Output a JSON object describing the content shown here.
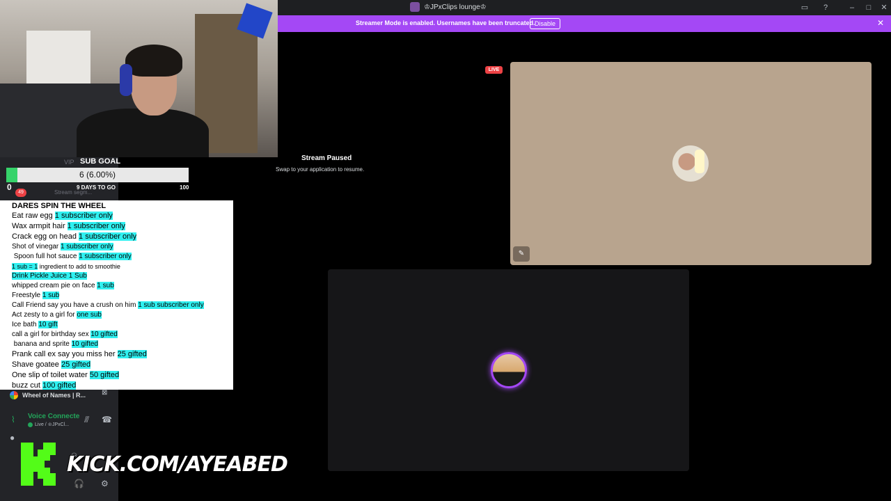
{
  "window": {
    "title": "♔JPxClips lounge♔"
  },
  "banner": {
    "text": "Streamer Mode is enabled. Usernames have been truncated.",
    "button_label": "Disable",
    "color": "#a448f5"
  },
  "sub_goal": {
    "title": "SUB GOAL",
    "value_text": "6 (6.00%)",
    "progress_percent": 6,
    "start_label": "0",
    "end_label": "100",
    "days_label": "9 DAYS TO GO",
    "vip_label": "VIP",
    "badge_count": "49",
    "segment_label": "Stream segm..."
  },
  "dares": {
    "title": "DARES SPIN THE WHEEL",
    "items": [
      {
        "text": "Eat raw egg ",
        "tag": "1 subscriber only"
      },
      {
        "text": "Wax armpit hair ",
        "tag": "1 subscriber only"
      },
      {
        "text": "Crack egg on head ",
        "tag": "1 subscriber only"
      },
      {
        "text": "Shot of vinegar ",
        "tag": "1 subscriber only"
      },
      {
        "text": " Spoon full hot sauce ",
        "tag": "1 subscriber only"
      },
      {
        "text": "",
        "tag": "1 sub = 1",
        "suffix": " ingredient to add to smoothie"
      },
      {
        "text": "",
        "tag": "Drink Pickle Juice 1 Sub"
      },
      {
        "text": "whipped cream pie on face ",
        "tag": "1 sub"
      },
      {
        "text": "Freestyle ",
        "tag": "1 sub"
      },
      {
        "text": "Call Friend say you have a crush on him ",
        "tag": "1 sub subscriber only"
      },
      {
        "text": "Act zesty to a girl for ",
        "tag": "one sub"
      },
      {
        "text": "Ice bath ",
        "tag": "10 gift"
      },
      {
        "text": "call a girl for birthday sex ",
        "tag": "10 gifted"
      },
      {
        "text": " banana and sprite ",
        "tag": "10 gifted"
      },
      {
        "text": "Prank call ex say you miss her ",
        "tag": "25 gifted"
      },
      {
        "text": "Shave goatee ",
        "tag": "25 gifted"
      },
      {
        "text": "One slip of toilet water ",
        "tag": "50 gifted"
      },
      {
        "text": "buzz cut ",
        "tag": "100 gifted"
      }
    ]
  },
  "sidebar": {
    "wheel_tab": "Wheel of Names | R...",
    "voice_status": "Voice Connecte",
    "voice_channel": "Live / ♔JPxCl..."
  },
  "kick": {
    "url": "KICK.COM/AYEABED",
    "brand_color": "#53fc18"
  },
  "stage": {
    "paused_title": "Stream Paused",
    "paused_sub": "Swap to your application to resume.",
    "live_label": "LIVE"
  }
}
